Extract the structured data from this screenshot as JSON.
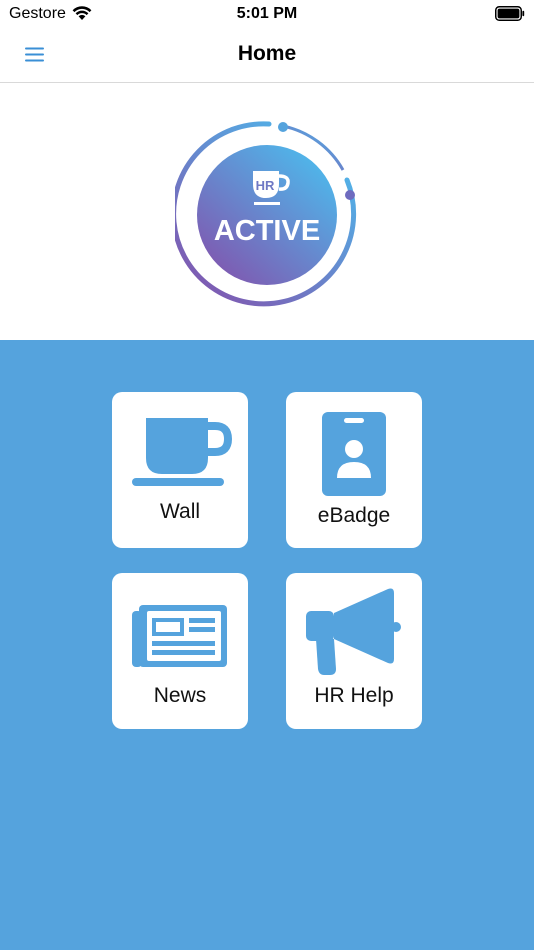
{
  "status_bar": {
    "carrier": "Gestore",
    "time": "5:01 PM",
    "wifi_icon": "wifi-icon",
    "battery_icon": "battery-icon"
  },
  "nav": {
    "title": "Home",
    "menu_icon": "hamburger-menu-icon"
  },
  "logo": {
    "text_top": "HR",
    "text_main": "ACTIVE"
  },
  "tiles": [
    {
      "label": "Wall",
      "icon": "coffee-cup-icon"
    },
    {
      "label": "eBadge",
      "icon": "id-badge-icon"
    },
    {
      "label": "News",
      "icon": "newspaper-icon"
    },
    {
      "label": "HR Help",
      "icon": "megaphone-icon"
    }
  ],
  "colors": {
    "background_blue": "#55a3dd",
    "tile_icon_blue": "#55a3dd",
    "menu_blue": "#3a8fd6",
    "logo_gradient_start": "#4fb6ea",
    "logo_gradient_end": "#7e5bb2"
  }
}
